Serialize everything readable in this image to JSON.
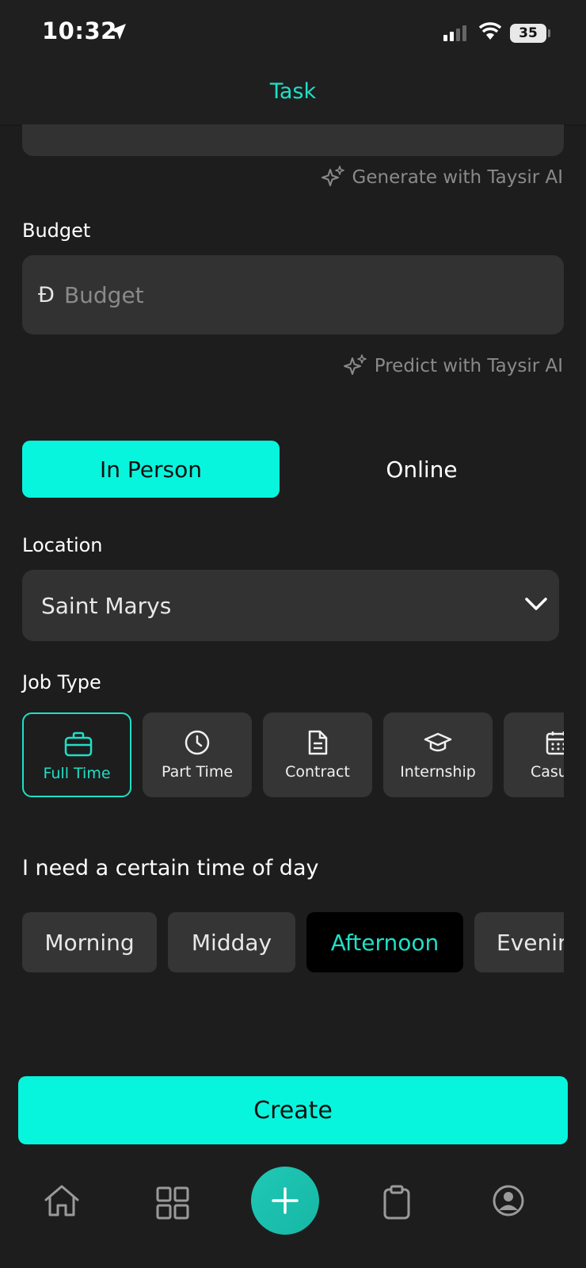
{
  "status_bar": {
    "time": "10:32",
    "battery": "35"
  },
  "header": {
    "title": "Task"
  },
  "ai": {
    "generate_label": "Generate with Taysir AI",
    "predict_label": "Predict with Taysir AI"
  },
  "budget": {
    "label": "Budget",
    "currency": "Đ",
    "placeholder": "Budget",
    "value": ""
  },
  "mode": {
    "in_person": "In Person",
    "online": "Online",
    "selected": "In Person"
  },
  "location": {
    "label": "Location",
    "value": "Saint Marys"
  },
  "job_type": {
    "label": "Job Type",
    "selected": "Full Time",
    "options": [
      {
        "label": "Full Time",
        "icon": "briefcase-icon"
      },
      {
        "label": "Part Time",
        "icon": "clock-icon"
      },
      {
        "label": "Contract",
        "icon": "document-icon"
      },
      {
        "label": "Internship",
        "icon": "graduation-cap-icon"
      },
      {
        "label": "Casu",
        "icon": "calendar-icon"
      }
    ]
  },
  "time_of_day": {
    "label": "I need a certain time of day",
    "selected": "Afternoon",
    "options": [
      "Morning",
      "Midday",
      "Afternoon",
      "Evenir"
    ]
  },
  "create_label": "Create",
  "tabbar": {
    "items": [
      "home-icon",
      "grid-icon",
      "plus-icon",
      "clipboard-icon",
      "profile-icon"
    ]
  },
  "colors": {
    "accent": "#08f5dd",
    "accent_text": "#1ee0c7",
    "background": "#1d1d1d",
    "field": "#323232"
  }
}
